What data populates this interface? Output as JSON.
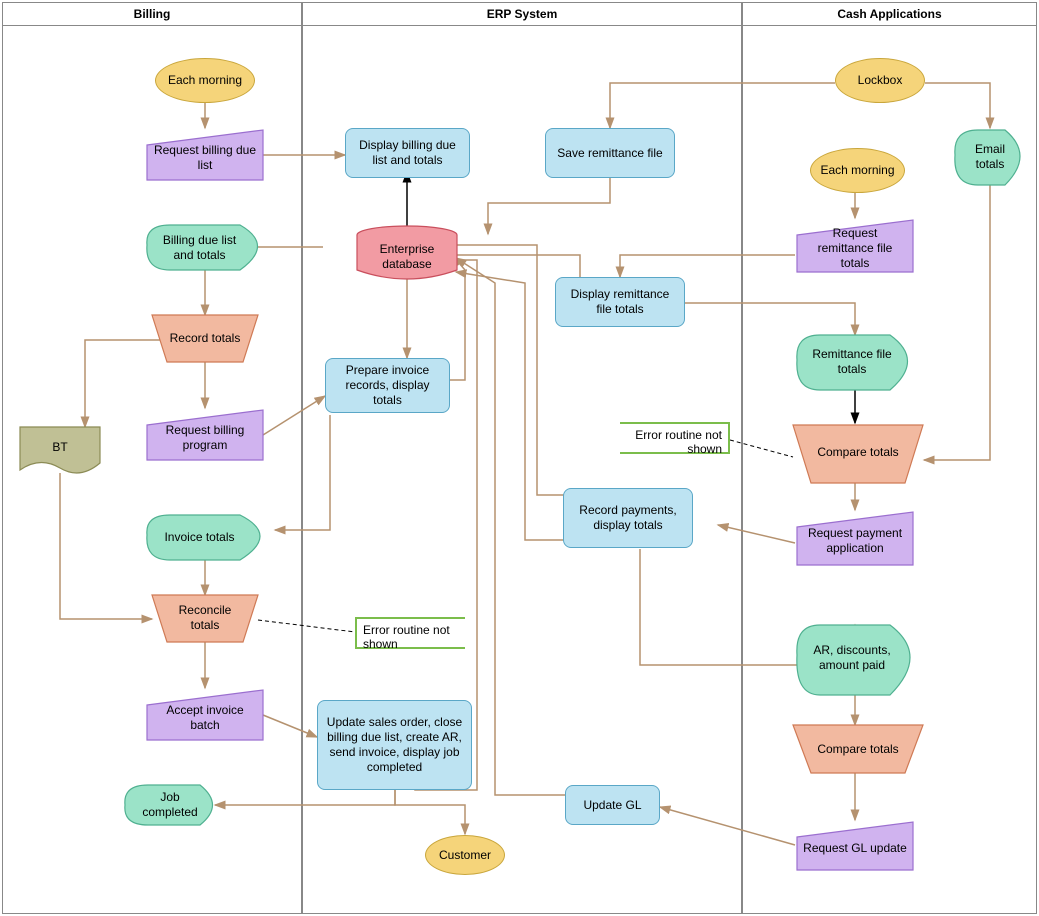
{
  "lanes": {
    "billing": "Billing",
    "erp": "ERP System",
    "cash": "Cash Applications"
  },
  "nodes": {
    "each_morning1": "Each morning",
    "request_billing_due": "Request billing due list",
    "billing_due_list": "Billing due list and totals",
    "record_totals1": "Record totals",
    "bt": "BT",
    "request_billing_prog": "Request billing program",
    "invoice_totals": "Invoice totals",
    "reconcile_totals": "Reconcile totals",
    "accept_invoice": "Accept invoice batch",
    "job_completed": "Job completed",
    "display_billing": "Display billing due list and totals",
    "enterprise_db": "Enterprise database",
    "prepare_invoice": "Prepare invoice records, display totals",
    "update_sales": "Update sales order, close billing due list, create AR, send invoice, display job completed",
    "customer": "Customer",
    "save_remit": "Save remittance file",
    "display_remit": "Display remittance file totals",
    "record_payments": "Record payments, display totals",
    "update_gl": "Update GL",
    "lockbox": "Lockbox",
    "each_morning2": "Each morning",
    "email_totals": "Email totals",
    "request_remit": "Request remittance file totals",
    "remit_totals": "Remittance file totals",
    "compare_totals1": "Compare totals",
    "request_payment": "Request payment application",
    "ar_discounts": "AR, discounts, amount paid",
    "compare_totals2": "Compare totals",
    "request_gl": "Request GL update",
    "error1": "Error routine not shown",
    "error2": "Error routine not shown"
  },
  "chart_data": {
    "type": "swimlane-flowchart",
    "lanes": [
      "Billing",
      "ERP System",
      "Cash Applications"
    ],
    "shapes": {
      "terminator": [
        "Each morning (Billing)",
        "Each morning (Cash)",
        "Lockbox",
        "Customer"
      ],
      "manual_input": [
        "Request billing due list",
        "Request billing program",
        "Accept invoice batch",
        "Request remittance file totals",
        "Request payment application",
        "Request GL update"
      ],
      "display": [
        "Billing due list and totals",
        "Invoice totals",
        "Job completed",
        "Email totals",
        "Remittance file totals",
        "AR, discounts, amount paid"
      ],
      "manual_operation": [
        "Record totals",
        "Reconcile totals",
        "Compare totals (1)",
        "Compare totals (2)"
      ],
      "process": [
        "Display billing due list and totals",
        "Prepare invoice records, display totals",
        "Update sales order, close billing due list, create AR, send invoice, display job completed",
        "Save remittance file",
        "Display remittance file totals",
        "Record payments, display totals",
        "Update GL"
      ],
      "datastore": [
        "Enterprise database"
      ],
      "document": [
        "BT"
      ],
      "annotation": [
        "Error routine not shown (Reconcile totals)",
        "Error routine not shown (Compare totals)"
      ]
    },
    "edges": [
      [
        "Each morning (Billing)",
        "Request billing due list"
      ],
      [
        "Request billing due list",
        "Display billing due list and totals"
      ],
      [
        "Enterprise database",
        "Display billing due list and totals"
      ],
      [
        "Enterprise database",
        "Billing due list and totals"
      ],
      [
        "Billing due list and totals",
        "Record totals"
      ],
      [
        "Record totals",
        "BT"
      ],
      [
        "Record totals",
        "Request billing program"
      ],
      [
        "Request billing program",
        "Prepare invoice records, display totals"
      ],
      [
        "Enterprise database",
        "Prepare invoice records, display totals"
      ],
      [
        "Prepare invoice records, display totals",
        "Invoice totals"
      ],
      [
        "Prepare invoice records, display totals",
        "Enterprise database"
      ],
      [
        "Invoice totals",
        "Reconcile totals"
      ],
      [
        "BT",
        "Reconcile totals"
      ],
      [
        "Reconcile totals",
        "Accept invoice batch"
      ],
      [
        "Accept invoice batch",
        "Update sales order…"
      ],
      [
        "Update sales order…",
        "Job completed"
      ],
      [
        "Update sales order…",
        "Customer"
      ],
      [
        "Update sales order…",
        "Enterprise database"
      ],
      [
        "Lockbox",
        "Save remittance file"
      ],
      [
        "Lockbox",
        "Email totals"
      ],
      [
        "Save remittance file",
        "Enterprise database"
      ],
      [
        "Each morning (Cash)",
        "Request remittance file totals"
      ],
      [
        "Request remittance file totals",
        "Display remittance file totals"
      ],
      [
        "Enterprise database",
        "Display remittance file totals"
      ],
      [
        "Display remittance file totals",
        "Remittance file totals"
      ],
      [
        "Remittance file totals",
        "Compare totals (1)"
      ],
      [
        "Email totals",
        "Compare totals (1)"
      ],
      [
        "Compare totals (1)",
        "Request payment application"
      ],
      [
        "Request payment application",
        "Record payments, display totals"
      ],
      [
        "Record payments, display totals",
        "Enterprise database"
      ],
      [
        "Enterprise database",
        "Record payments, display totals"
      ],
      [
        "Record payments, display totals",
        "AR, discounts, amount paid"
      ],
      [
        "AR, discounts, amount paid",
        "Compare totals (2)"
      ],
      [
        "Compare totals (2)",
        "Request GL update"
      ],
      [
        "Request GL update",
        "Update GL"
      ],
      [
        "Update GL",
        "Enterprise database"
      ]
    ]
  }
}
